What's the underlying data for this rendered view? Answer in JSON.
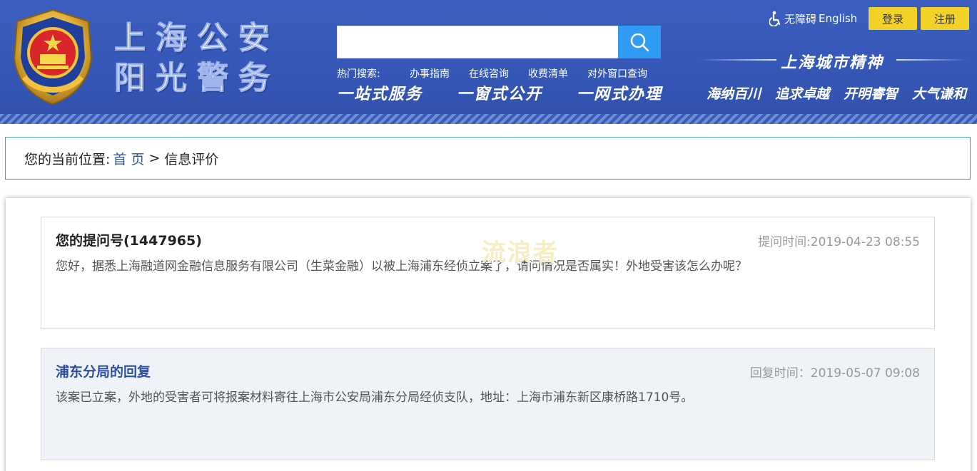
{
  "header": {
    "title_line1": "上海公安",
    "title_line2": "阳光警务",
    "search": {
      "value": "",
      "placeholder": ""
    },
    "hot_label": "热门搜索:",
    "hot_links": [
      "办事指南",
      "在线咨询",
      "收费清单",
      "对外窗口查询"
    ],
    "slogans": [
      "一站式服务",
      "一窗式公开",
      "一网式办理"
    ],
    "accessibility_label": "无障碍",
    "english_label": "English",
    "login_label": "登录",
    "register_label": "注册",
    "spirit_title": "上海城市精神",
    "spirit_words": [
      "海纳百川",
      "追求卓越",
      "开明睿智",
      "大气谦和"
    ],
    "colors": {
      "header_bg": "#3557b7",
      "search_button": "#2f9bf2",
      "button_yellow": "#f3d227"
    }
  },
  "breadcrumb": {
    "prefix": "您的当前位置:",
    "home": "首 页",
    "separator": ">",
    "current": "信息评价"
  },
  "question": {
    "title": "您的提问号(1447965)",
    "time": "提问时间:2019-04-23 08:55",
    "body": "您好，据悉上海融道网金融信息服务有限公司（生菜金融）以被上海浦东经侦立案了，请问情况是否属实！外地受害该怎么办呢？"
  },
  "reply": {
    "title": "浦东分局的回复",
    "time": "回复时间：2019-05-07 09:08",
    "body": "该案已立案，外地的受害者可将报案材料寄往上海市公安局浦东分局经侦支队，地址：上海市浦东新区康桥路1710号。"
  },
  "watermark": "流浪者"
}
